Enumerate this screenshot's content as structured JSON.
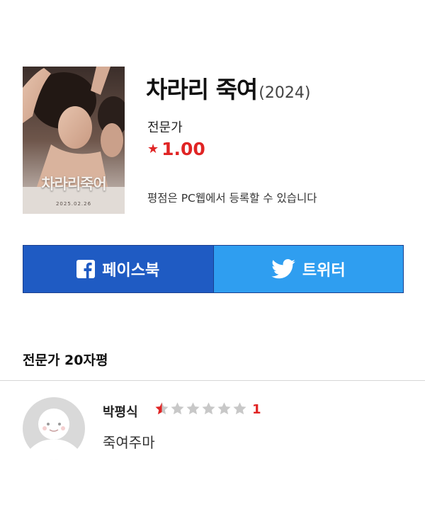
{
  "movie": {
    "title": "차라리 죽여",
    "year": "(2024)",
    "poster": {
      "title_text": "차라리죽어",
      "date_text": "2025.02.26"
    }
  },
  "critic": {
    "label": "전문가",
    "rating": "1.00",
    "rating_note": "평점은 PC웹에서 등록할 수 있습니다"
  },
  "share": {
    "facebook_label": "페이스북",
    "twitter_label": "트위터",
    "facebook_color": "#1f5bc3",
    "twitter_color": "#2f9ef0"
  },
  "reviews_section": {
    "title": "전문가 20자평"
  },
  "reviews": [
    {
      "name": "박평식",
      "stars": 1,
      "max_stars": 6,
      "score": "1",
      "text": "죽여주마",
      "avatar_icon": "default-avatar-icon"
    }
  ],
  "colors": {
    "accent_red": "#e02424",
    "star_empty": "#c8c8c8"
  }
}
